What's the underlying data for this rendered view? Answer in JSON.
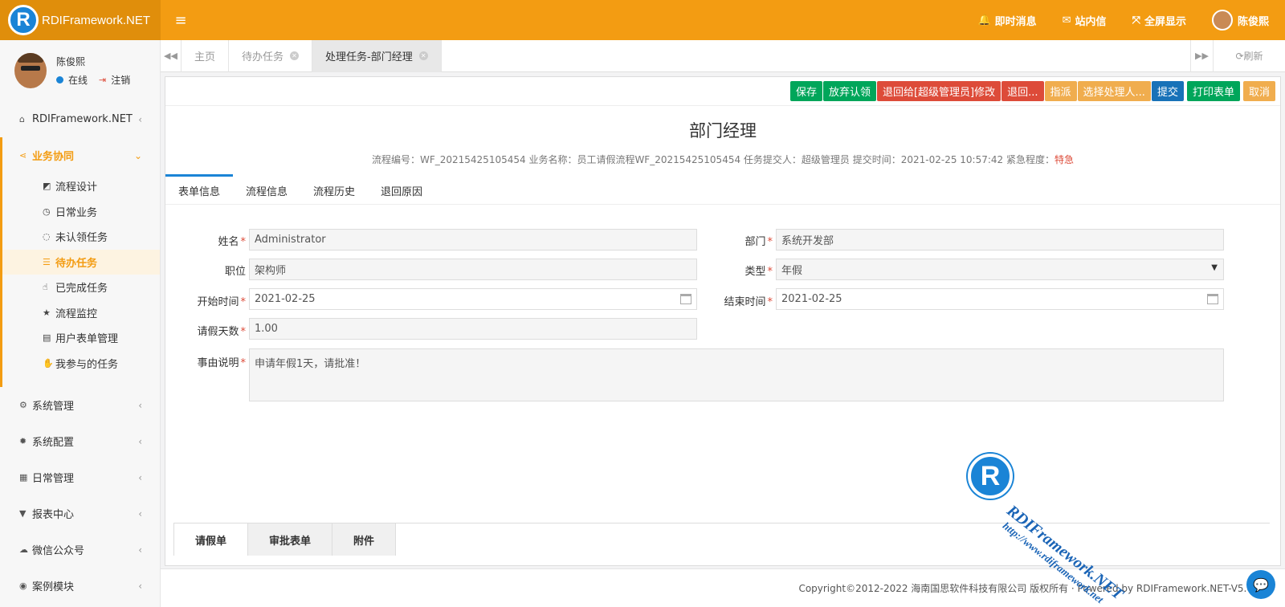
{
  "header": {
    "logo_letter": "R",
    "logo_text": "RDIFramework.NET",
    "menu_toggle": "≡",
    "items": [
      {
        "icon": "bell-icon",
        "glyph": "🔔",
        "label": "即时消息"
      },
      {
        "icon": "envelope-icon",
        "glyph": "✉",
        "label": "站内信"
      },
      {
        "icon": "fullscreen-icon",
        "glyph": "⤧",
        "label": "全屏显示"
      }
    ],
    "user_name": "陈俊熙"
  },
  "sidebar": {
    "user_name": "陈俊熙",
    "status_online": "在线",
    "logout": "注销",
    "menu_top": {
      "label": "RDIFramework.NET",
      "icon": "home-icon"
    },
    "menu_open": {
      "label": "业务协同",
      "icon": "share-icon"
    },
    "sub_items": [
      {
        "label": "流程设计",
        "icon": "design-icon",
        "glyph": "◩"
      },
      {
        "label": "日常业务",
        "icon": "clock-icon",
        "glyph": "◷"
      },
      {
        "label": "未认领任务",
        "icon": "circle-notch-icon",
        "glyph": "◌"
      },
      {
        "label": "待办任务",
        "icon": "list-icon",
        "glyph": "☰"
      },
      {
        "label": "已完成任务",
        "icon": "hand-icon",
        "glyph": "☝"
      },
      {
        "label": "流程监控",
        "icon": "star-icon",
        "glyph": "★"
      },
      {
        "label": "用户表单管理",
        "icon": "form-icon",
        "glyph": "▤"
      },
      {
        "label": "我参与的任务",
        "icon": "hand-paper-icon",
        "glyph": "✋"
      }
    ],
    "menu_bottom": [
      {
        "label": "系统管理",
        "icon": "cogs-icon",
        "glyph": "⚙"
      },
      {
        "label": "系统配置",
        "icon": "gear-icon",
        "glyph": "✹"
      },
      {
        "label": "日常管理",
        "icon": "calendar-icon",
        "glyph": "▦"
      },
      {
        "label": "报表中心",
        "icon": "filter-icon",
        "glyph": "▼"
      },
      {
        "label": "微信公众号",
        "icon": "wechat-icon",
        "glyph": "☁"
      },
      {
        "label": "案例模块",
        "icon": "eye-icon",
        "glyph": "◉"
      }
    ]
  },
  "tabs": {
    "items": [
      "主页",
      "待办任务",
      "处理任务-部门经理"
    ],
    "refresh": "刷新"
  },
  "toolbar": {
    "save": "保存",
    "abandon": "放弃认领",
    "return_to": "退回给[超级管理员]修改",
    "return_other": "退回...",
    "assign": "指派",
    "choose_handler": "选择处理人...",
    "submit": "提交",
    "print": "打印表单",
    "cancel": "取消"
  },
  "form": {
    "title": "部门经理",
    "meta_prefix": "流程编号：WF_20215425105454 业务名称：员工请假流程WF_20215425105454 任务提交人：超级管理员 提交时间：2021-02-25 10:57:42 紧急程度：",
    "urgency": "特急",
    "tabs": [
      "表单信息",
      "流程信息",
      "流程历史",
      "退回原因"
    ],
    "fields": {
      "name_label": "姓名",
      "name_value": "Administrator",
      "dept_label": "部门",
      "dept_value": "系统开发部",
      "position_label": "职位",
      "position_value": "架构师",
      "type_label": "类型",
      "type_value": "年假",
      "start_label": "开始时间",
      "start_value": "2021-02-25",
      "end_label": "结束时间",
      "end_value": "2021-02-25",
      "days_label": "请假天数",
      "days_value": "1.00",
      "reason_label": "事由说明",
      "reason_value": "申请年假1天，请批准！"
    },
    "bottom_tabs": [
      "请假单",
      "审批表单",
      "附件"
    ]
  },
  "footer": {
    "copyright": "Copyright©2012-2022 海南国思软件科技有限公司 版权所有 · Powered by RDIFramework.NET-V5.0"
  },
  "watermark": {
    "letter": "R",
    "line1": "RDIFramework.NET",
    "line2": "http://www.rdiframework.net"
  },
  "colors": {
    "accent": "#f39c12",
    "brand_blue": "#1a84d6",
    "green": "#00a65a",
    "red": "#dd4b39",
    "orange": "#f0ad4e"
  }
}
